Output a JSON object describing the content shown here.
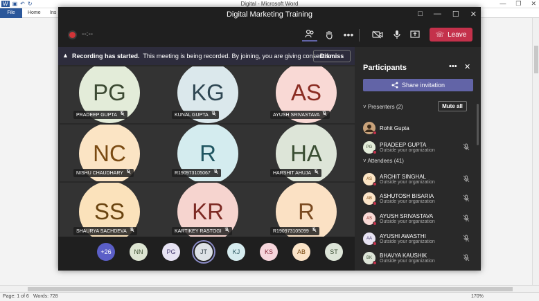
{
  "word": {
    "title": "Digital  -  Microsoft Word",
    "tabs": [
      "File",
      "Home",
      "Ins"
    ],
    "status_page": "Page: 1 of 6",
    "status_words": "Words: 728",
    "zoom": "170%"
  },
  "teams": {
    "window_title": "Digital Marketing Training",
    "recording_time": "--:--",
    "leave_label": "Leave",
    "banner": {
      "title": "Recording has started.",
      "text": "This meeting is being recorded. By joining, you are giving consent for...",
      "dismiss": "Dismiss"
    },
    "tiles": [
      {
        "initials": "PG",
        "name": "PRADEEP GUPTA",
        "bg": "#e3ecd9",
        "fg": "#3c4a33"
      },
      {
        "initials": "KG",
        "name": "KUNAL GUPTA",
        "bg": "#dbe8ec",
        "fg": "#2f4753"
      },
      {
        "initials": "AS",
        "name": "AYUSH SRIVASTAVA",
        "bg": "#f9d9d5",
        "fg": "#8a2c22"
      },
      {
        "initials": "NC",
        "name": "NISHU CHAUDHARY",
        "bg": "#fbe4c4",
        "fg": "#7a4a12"
      },
      {
        "initials": "R",
        "name": "R190973105067",
        "bg": "#d4ecef",
        "fg": "#1f5560"
      },
      {
        "initials": "HA",
        "name": "HARSHIT AHUJA",
        "bg": "#dde5d8",
        "fg": "#3a4e33"
      },
      {
        "initials": "SS",
        "name": "SHAURYA SACHDEVA",
        "bg": "#fbe2bb",
        "fg": "#6a4410"
      },
      {
        "initials": "KR",
        "name": "KARTIKEY RASTOGI",
        "bg": "#f6d4cf",
        "fg": "#7d2a24"
      },
      {
        "initials": "R",
        "name": "R190973105099",
        "bg": "#fbe1c4",
        "fg": "#7a4a20"
      }
    ],
    "bottom_avatars": [
      {
        "label": "+26",
        "bg": "#5b5fc7",
        "fg": "#ffffff"
      },
      {
        "label": "NN",
        "bg": "#dde5d2",
        "fg": "#3f5233"
      },
      {
        "label": "PG",
        "bg": "#e7e3f3",
        "fg": "#4a3f74"
      },
      {
        "label": "JT",
        "bg": "#dde2e6",
        "fg": "#3a464f"
      },
      {
        "label": "KJ",
        "bg": "#d6ecef",
        "fg": "#2f5b63"
      },
      {
        "label": "KS",
        "bg": "#f7d6dc",
        "fg": "#8b2d3f"
      },
      {
        "label": "AB",
        "bg": "#fbe4c8",
        "fg": "#7a4a12"
      },
      {
        "label": "ST",
        "bg": "#dde5d8",
        "fg": "#3a4e33"
      }
    ],
    "panel": {
      "title": "Participants",
      "share": "Share invitation",
      "presenters_label": "Presenters (2)",
      "mute_all": "Mute all",
      "attendees_label": "Attendees (41)",
      "people": [
        {
          "name": "Rohit Gupta",
          "org": "",
          "initials": "",
          "bg": "#c8a27a",
          "fg": "#3a2a1a"
        },
        {
          "name": "PRADEEP GUPTA",
          "org": "Outside your organization",
          "initials": "PG",
          "bg": "#e3ecd9",
          "fg": "#3c4a33"
        },
        {
          "name": "ARCHIT SINGHAL",
          "org": "Outside your organization",
          "initials": "AS",
          "bg": "#fbe4c4",
          "fg": "#7a4a12"
        },
        {
          "name": "ASHUTOSH BISARIA",
          "org": "Outside your organization",
          "initials": "AB",
          "bg": "#fbe4c8",
          "fg": "#7a4a12"
        },
        {
          "name": "AYUSH SRIVASTAVA",
          "org": "Outside your organization",
          "initials": "AS",
          "bg": "#f9d9d5",
          "fg": "#8a2c22"
        },
        {
          "name": "AYUSHI AWASTHI",
          "org": "Outside your organization",
          "initials": "AA",
          "bg": "#e7e3f3",
          "fg": "#4a3f74"
        },
        {
          "name": "BHAVYA KAUSHIK",
          "org": "Outside your organization",
          "initials": "BK",
          "bg": "#dde5d8",
          "fg": "#3a4e33"
        }
      ]
    }
  }
}
